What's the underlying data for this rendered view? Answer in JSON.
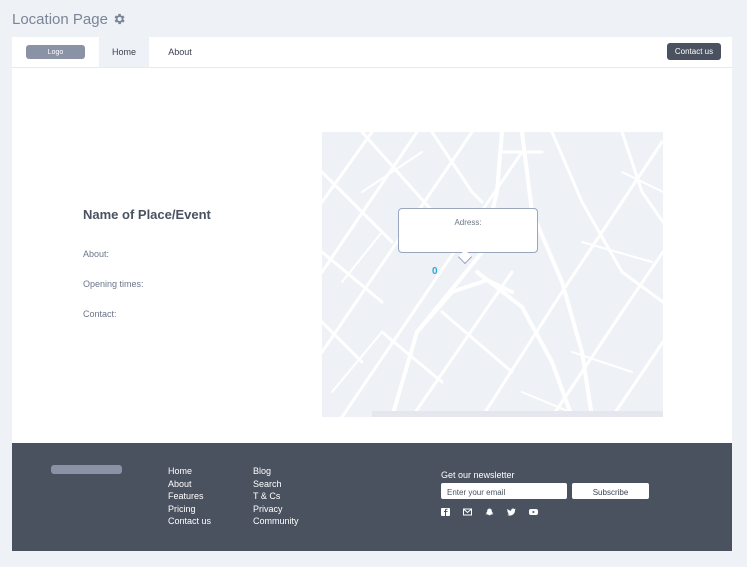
{
  "page": {
    "title": "Location Page"
  },
  "nav": {
    "logo": "Logo",
    "home": "Home",
    "about": "About",
    "contact": "Contact us"
  },
  "place": {
    "title": "Name of Place/Event",
    "about_label": "About:",
    "opening_label": "Opening times:",
    "contact_label": "Contact:"
  },
  "map": {
    "address_label": "Adress:",
    "pin_value": "0"
  },
  "footer": {
    "col1": [
      "Home",
      "About",
      "Features",
      "Pricing",
      "Contact us"
    ],
    "col2": [
      "Blog",
      "Search",
      "T & Cs",
      "Privacy",
      "Community"
    ],
    "newsletter_title": "Get our newsletter",
    "email_placeholder": "Enter your email",
    "subscribe_label": "Subscribe",
    "social_icons": [
      "facebook-icon",
      "email-icon",
      "snapchat-icon",
      "twitter-icon",
      "youtube-icon"
    ]
  },
  "colors": {
    "footer_bg": "#4a515f",
    "logo_pill": "#8a93a5",
    "map_bg": "#eef1f5",
    "pin": "#29a8e0",
    "page_bg": "#eef1f5"
  }
}
